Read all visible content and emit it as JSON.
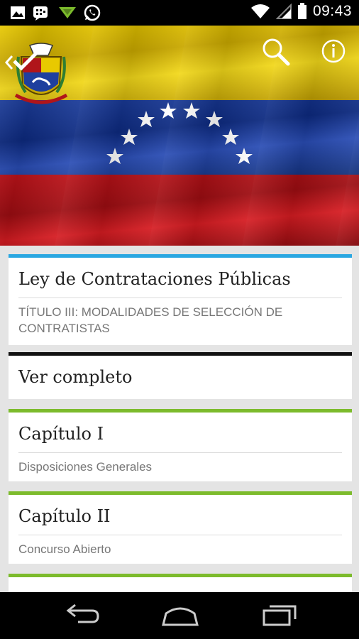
{
  "status_bar": {
    "time": "09:43",
    "icons": [
      "image-icon",
      "bbm-icon",
      "download-icon",
      "whatsapp-icon",
      "wifi-icon",
      "signal-icon",
      "battery-icon"
    ]
  },
  "header": {
    "back_icon": "chevron-left-icon",
    "search_icon": "search-icon",
    "info_icon": "info-icon"
  },
  "cards": {
    "law": {
      "title": "Ley de Contrataciones Públicas",
      "subtitle": "TÍTULO III: MODALIDADES DE SELECCIÓN DE CONTRATISTAS",
      "accent": "#2aa7e1"
    },
    "full": {
      "title": "Ver completo",
      "accent": "#111111"
    },
    "chapter1": {
      "title": "Capítulo I",
      "subtitle": "Disposiciones Generales",
      "accent": "#7cbb2c"
    },
    "chapter2": {
      "title": "Capítulo II",
      "subtitle": "Concurso Abierto",
      "accent": "#7cbb2c"
    }
  },
  "nav_bar": {
    "back": "back-icon",
    "home": "home-icon",
    "recents": "recents-icon"
  }
}
